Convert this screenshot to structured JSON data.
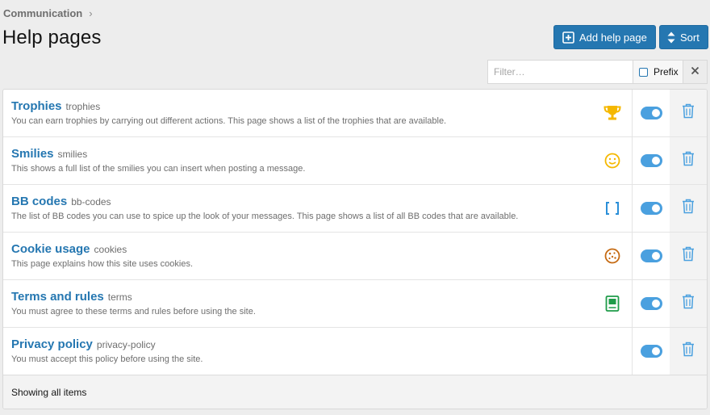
{
  "breadcrumb": {
    "label": "Communication",
    "separator": "›"
  },
  "page": {
    "title": "Help pages"
  },
  "actions": {
    "add_label": "Add help page",
    "sort_label": "Sort"
  },
  "filter": {
    "placeholder": "Filter…",
    "prefix_label": "Prefix",
    "prefix_checked": false,
    "clear_icon": "close-icon"
  },
  "items": [
    {
      "title": "Trophies",
      "slug": "trophies",
      "description": "You can earn trophies by carrying out different actions. This page shows a list of the trophies that are available.",
      "icon": "trophy-icon",
      "icon_color": "#f5b800",
      "enabled": true
    },
    {
      "title": "Smilies",
      "slug": "smilies",
      "description": "This shows a full list of the smilies you can insert when posting a message.",
      "icon": "smiley-icon",
      "icon_color": "#f5b800",
      "enabled": true
    },
    {
      "title": "BB codes",
      "slug": "bb-codes",
      "description": "The list of BB codes you can use to spice up the look of your messages. This page shows a list of all BB codes that are available.",
      "icon": "brackets-icon",
      "icon_color": "#2b8fd8",
      "enabled": true
    },
    {
      "title": "Cookie usage",
      "slug": "cookies",
      "description": "This page explains how this site uses cookies.",
      "icon": "cookie-icon",
      "icon_color": "#c56a12",
      "enabled": true
    },
    {
      "title": "Terms and rules",
      "slug": "terms",
      "description": "You must agree to these terms and rules before using the site.",
      "icon": "book-icon",
      "icon_color": "#1f9c4a",
      "enabled": true
    },
    {
      "title": "Privacy policy",
      "slug": "privacy-policy",
      "description": "You must accept this policy before using the site.",
      "icon": "",
      "icon_color": "",
      "enabled": true
    }
  ],
  "footer": {
    "text": "Showing all items"
  },
  "colors": {
    "accent": "#2577b1",
    "toggle_on": "#4aa0df",
    "delete_icon": "#4aa0df",
    "page_bg": "#ededed"
  }
}
